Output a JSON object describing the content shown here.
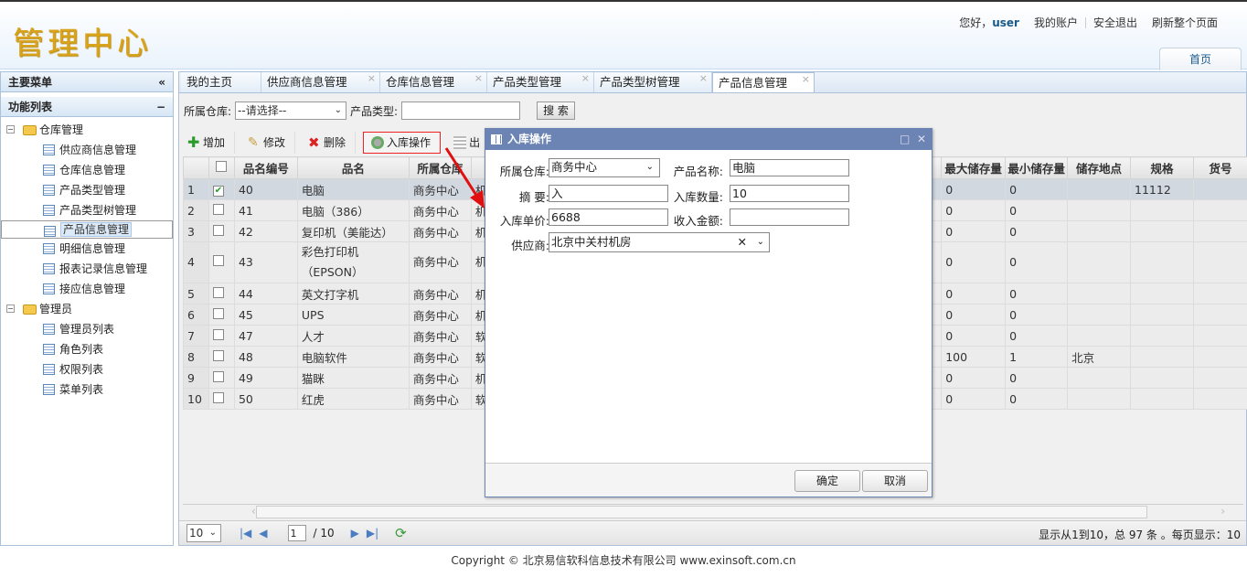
{
  "header": {
    "logo": "管理中心",
    "greeting": "您好，",
    "username": "user",
    "my_account": "我的账户",
    "logout": "安全退出",
    "refresh": "刷新整个页面",
    "home_tab": "首页"
  },
  "sidebar": {
    "title": "主要菜单",
    "collapse_icon": "«",
    "section": "功能列表",
    "section_toggle": "−",
    "groups": [
      {
        "label": "仓库管理",
        "items": [
          "供应商信息管理",
          "仓库信息管理",
          "产品类型管理",
          "产品类型树管理",
          "产品信息管理",
          "明细信息管理",
          "报表记录信息管理",
          "接应信息管理"
        ]
      },
      {
        "label": "管理员",
        "items": [
          "管理员列表",
          "角色列表",
          "权限列表",
          "菜单列表"
        ]
      }
    ],
    "selected": "产品信息管理"
  },
  "tabs": [
    "我的主页",
    "供应商信息管理",
    "仓库信息管理",
    "产品类型管理",
    "产品类型树管理",
    "产品信息管理"
  ],
  "active_tab": "产品信息管理",
  "search": {
    "warehouse_label": "所属仓库:",
    "warehouse_value": "--请选择--",
    "type_label": "产品类型:",
    "type_value": "",
    "search_button": "搜 索"
  },
  "toolbar": {
    "add": "增加",
    "edit": "修改",
    "delete": "删除",
    "stock_in": "入库操作",
    "out": "出"
  },
  "grid": {
    "columns": [
      "品名编号",
      "品名",
      "所属仓库",
      "",
      "最大储存量",
      "最小储存量",
      "储存地点",
      "规格",
      "货号"
    ],
    "rows": [
      {
        "n": "1",
        "checked": true,
        "id": "40",
        "name": "电脑",
        "wh": "商务中心",
        "t": "机",
        "max": "0",
        "min": "0",
        "loc": "",
        "spec": "11112",
        "code": ""
      },
      {
        "n": "2",
        "checked": false,
        "id": "41",
        "name": "电脑（386）",
        "wh": "商务中心",
        "t": "机",
        "max": "0",
        "min": "0",
        "loc": "",
        "spec": "",
        "code": ""
      },
      {
        "n": "3",
        "checked": false,
        "id": "42",
        "name": "复印机（美能达）",
        "wh": "商务中心",
        "t": "机",
        "max": "0",
        "min": "0",
        "loc": "",
        "spec": "",
        "code": ""
      },
      {
        "n": "4",
        "checked": false,
        "id": "43",
        "name": "彩色打印机（EPSON）",
        "wh": "商务中心",
        "t": "机",
        "max": "0",
        "min": "0",
        "loc": "",
        "spec": "",
        "code": ""
      },
      {
        "n": "5",
        "checked": false,
        "id": "44",
        "name": "英文打字机",
        "wh": "商务中心",
        "t": "机",
        "max": "0",
        "min": "0",
        "loc": "",
        "spec": "",
        "code": ""
      },
      {
        "n": "6",
        "checked": false,
        "id": "45",
        "name": "UPS",
        "wh": "商务中心",
        "t": "机",
        "max": "0",
        "min": "0",
        "loc": "",
        "spec": "",
        "code": ""
      },
      {
        "n": "7",
        "checked": false,
        "id": "47",
        "name": "人才",
        "wh": "商务中心",
        "t": "软",
        "max": "0",
        "min": "0",
        "loc": "",
        "spec": "",
        "code": ""
      },
      {
        "n": "8",
        "checked": false,
        "id": "48",
        "name": "电脑软件",
        "wh": "商务中心",
        "t": "软",
        "max": "100",
        "min": "1",
        "loc": "北京",
        "spec": "",
        "code": ""
      },
      {
        "n": "9",
        "checked": false,
        "id": "49",
        "name": "猫眯",
        "wh": "商务中心",
        "t": "机",
        "max": "0",
        "min": "0",
        "loc": "",
        "spec": "",
        "code": ""
      },
      {
        "n": "10",
        "checked": false,
        "id": "50",
        "name": "红虎",
        "wh": "商务中心",
        "t": "软",
        "max": "0",
        "min": "0",
        "loc": "",
        "spec": "",
        "code": ""
      }
    ]
  },
  "pager": {
    "page_size": "10",
    "current_page": "1",
    "total_pages": "/ 10",
    "info": "显示从1到10，总 97 条 。每页显示：10"
  },
  "dialog": {
    "title": "入库操作",
    "warehouse_label": "所属仓库:",
    "warehouse_value": "商务中心",
    "product_label": "产品名称:",
    "product_value": "电脑",
    "summary_label": "摘 要:",
    "summary_value": "入",
    "qty_label": "入库数量:",
    "qty_value": "10",
    "price_label": "入库单价:",
    "price_value": "6688",
    "amount_label": "收入金额:",
    "amount_value": "",
    "supplier_label": "供应商:",
    "supplier_value": "北京中关村机房",
    "ok": "确定",
    "cancel": "取消"
  },
  "footer": {
    "copyright": "Copyright © 北京易信软科信息技术有限公司 www.exinsoft.com.cn"
  },
  "colors": {
    "dialog_title": "#6b84b4",
    "logo": "#d9a41c",
    "highlight": "#e22222"
  }
}
